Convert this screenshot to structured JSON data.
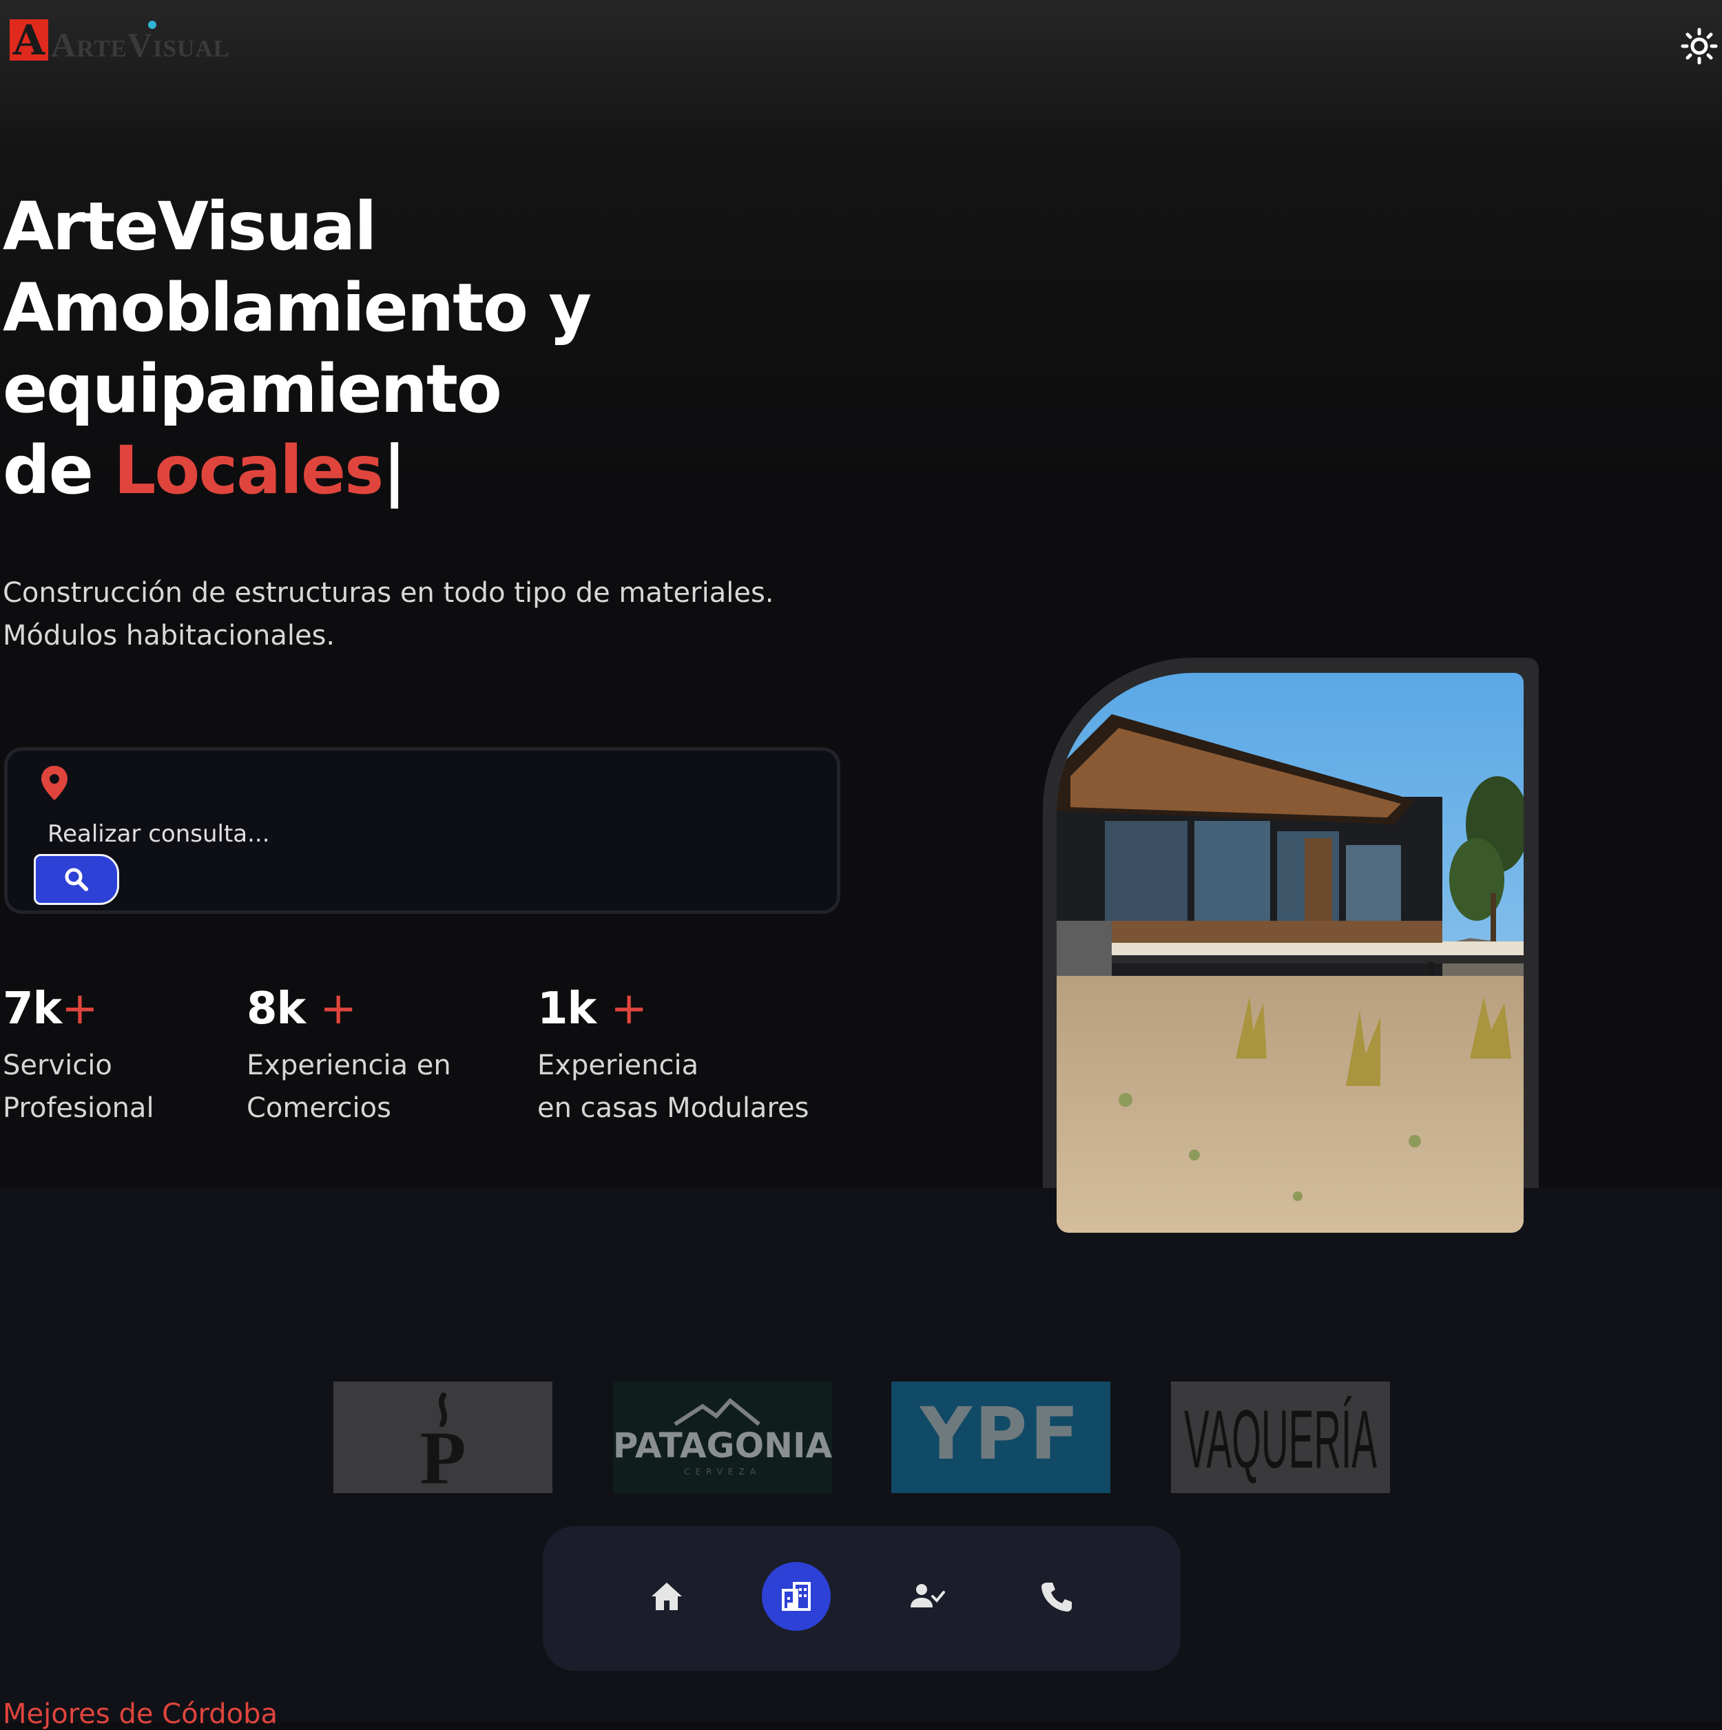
{
  "header": {
    "logo_text": "ArteVisual",
    "theme_icon": "sun-icon"
  },
  "hero": {
    "title_lines": [
      "ArteVisual",
      "Amoblamiento y",
      "equipamiento"
    ],
    "title_prefix": "de",
    "title_accent": "Locales",
    "title_caret": "|",
    "subtitle_lines": [
      "Construcción de estructuras en todo tipo de materiales.",
      "Módulos habitacionales."
    ]
  },
  "search": {
    "placeholder": "Realizar consulta...",
    "value": "",
    "location_icon": "map-pin-icon",
    "button_icon": "search-icon"
  },
  "stats": [
    {
      "number": "7k",
      "plus": "+",
      "label_lines": [
        "Servicio",
        "Profesional"
      ]
    },
    {
      "number": "8k",
      "plus": "+",
      "label_lines": [
        "Experiencia en",
        "Comercios"
      ]
    },
    {
      "number": "1k",
      "plus": "+",
      "label_lines": [
        "Experiencia",
        "en casas Modulares"
      ]
    }
  ],
  "brands": [
    {
      "name": "P",
      "bg": "#3b3b3e"
    },
    {
      "name": "PATAGONIA",
      "tagline": "CERVEZA",
      "bg": "#0f1d1c"
    },
    {
      "name": "YPF",
      "bg": "#114a66"
    },
    {
      "name": "VAQUERÍA",
      "bg": "#3a3a3c"
    }
  ],
  "bottom_nav": [
    {
      "icon": "home-icon",
      "active": false
    },
    {
      "icon": "building-icon",
      "active": true
    },
    {
      "icon": "user-check-icon",
      "active": false
    },
    {
      "icon": "phone-icon",
      "active": false
    }
  ],
  "footer": {
    "text": "Mejores de Córdoba"
  },
  "colors": {
    "accent": "#e0453d",
    "primary": "#2d41d6",
    "background": "#0e0e10"
  }
}
